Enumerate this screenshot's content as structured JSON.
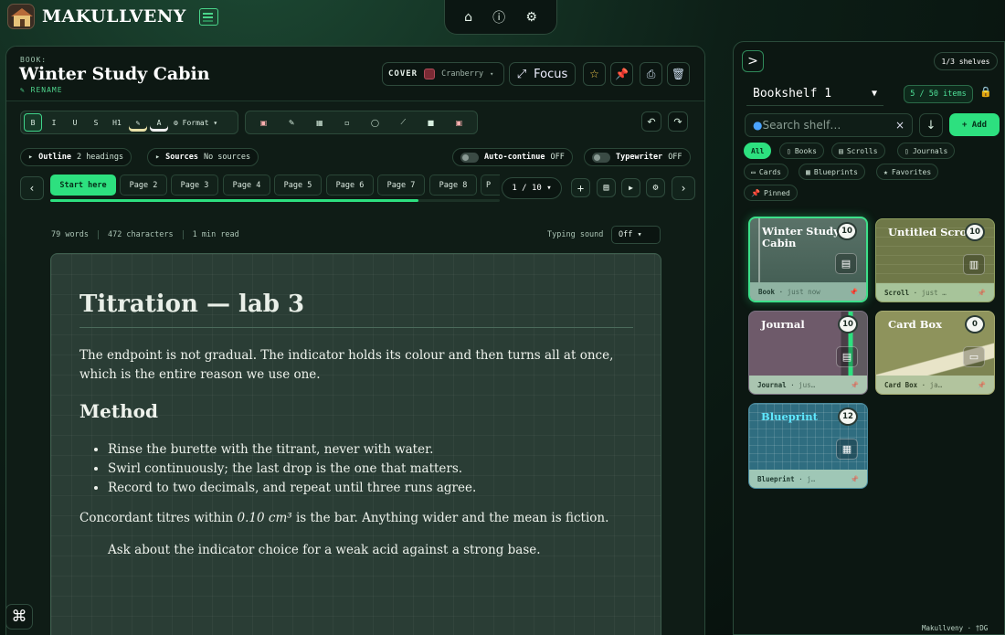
{
  "app": {
    "name": "MAKULLVENY"
  },
  "nav": {
    "home_icon": "⌂",
    "info_icon": "ⓘ",
    "settings_icon": "⚙"
  },
  "book": {
    "kicker": "BOOK:",
    "title": "Winter Study Cabin",
    "rename": "RENAME"
  },
  "header": {
    "cover_label": "COVER",
    "cover_value": "Cranberry",
    "cover_color": "#7a2a34",
    "focus_label": "Focus"
  },
  "toolbar": {
    "bold": "B",
    "italic": "I",
    "underline": "U",
    "strike": "S",
    "h1": "H1",
    "highlight": "A",
    "format": "Format"
  },
  "meta": {
    "outline_label": "Outline",
    "outline_value": "2 headings",
    "sources_label": "Sources",
    "sources_value": "No sources",
    "autocontinue_label": "Auto-continue",
    "autocontinue_value": "OFF",
    "typewriter_label": "Typewriter",
    "typewriter_value": "OFF"
  },
  "pages": {
    "tabs": [
      "Start here",
      "Page 2",
      "Page 3",
      "Page 4",
      "Page 5",
      "Page 6",
      "Page 7",
      "Page 8",
      "P"
    ],
    "indicator": "1 / 10",
    "progress": 0.82
  },
  "stats": {
    "words": "79 words",
    "chars": "472 characters",
    "read": "1 min read",
    "sound_label": "Typing sound",
    "sound_value": "Off"
  },
  "doc": {
    "h1": "Titration — lab 3",
    "p1": "The endpoint is not gradual. The indicator holds its colour and then turns all at once, which is the entire reason we use one.",
    "h2": "Method",
    "list": [
      "Rinse the burette with the titrant, never with water.",
      "Swirl continuously; the last drop is the one that matters.",
      "Record to two decimals, and repeat until three runs agree."
    ],
    "p2_pre": "Concordant titres within ",
    "p2_em": "0.10 cm³",
    "p2_post": " is the bar. Anything wider and the mean is fiction.",
    "p3": "Ask about the indicator choice for a weak acid against a strong base."
  },
  "shelf": {
    "count": "1/3 shelves",
    "name": "Bookshelf 1",
    "items": "5 / 50 items",
    "search_placeholder": "Search shelf…",
    "add": "+ Add",
    "filters": [
      "All",
      "Books",
      "Scrolls",
      "Journals",
      "Cards",
      "Blueprints",
      "Favorites",
      "Pinned"
    ],
    "cards": [
      {
        "name": "Winter Study Cabin",
        "count": "10",
        "type": "Book",
        "time": "just now",
        "icon": "book-icon"
      },
      {
        "name": "Untitled Scroll",
        "count": "10",
        "type": "Scroll",
        "time": "just …",
        "icon": "scroll-icon"
      },
      {
        "name": "Journal",
        "count": "10",
        "type": "Journal",
        "time": "jus…",
        "icon": "journal-icon"
      },
      {
        "name": "Card Box",
        "count": "0",
        "type": "Card Box",
        "time": "ja…",
        "icon": "cardbox-icon"
      },
      {
        "name": "Blueprint",
        "count": "12",
        "type": "Blueprint",
        "time": "j…",
        "icon": "blueprint-icon"
      }
    ]
  },
  "footer": {
    "text": "Makullveny · †DG"
  },
  "colors": {
    "accent": "#2de07f",
    "panel": "#0f1c16",
    "paper": "#2a3d35"
  }
}
